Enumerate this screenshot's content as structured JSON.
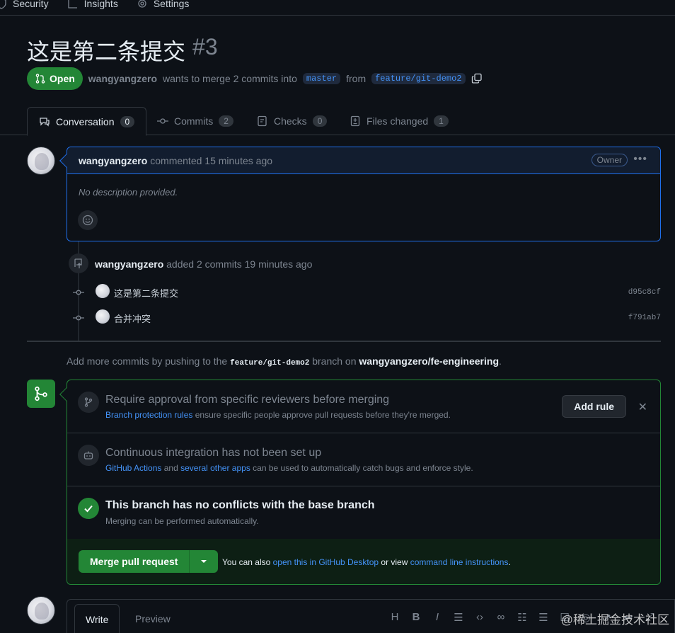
{
  "nav": {
    "security": "Security",
    "insights": "Insights",
    "settings": "Settings"
  },
  "pr": {
    "title": "这是第二条提交",
    "number": "#3",
    "state": "Open",
    "author": "wangyangzero",
    "merge_text": "wants to merge 2 commits into",
    "base": "master",
    "from_word": "from",
    "head": "feature/git-demo2"
  },
  "tabs": [
    {
      "label": "Conversation",
      "count": "0"
    },
    {
      "label": "Commits",
      "count": "2"
    },
    {
      "label": "Checks",
      "count": "0"
    },
    {
      "label": "Files changed",
      "count": "1"
    }
  ],
  "comment": {
    "author": "wangyangzero",
    "meta": "commented 15 minutes ago",
    "role": "Owner",
    "body": "No description provided."
  },
  "timeline": {
    "author": "wangyangzero",
    "event": "added 2 commits 19 minutes ago",
    "commits": [
      {
        "message": "这是第二条提交",
        "sha": "d95c8cf"
      },
      {
        "message": "合并冲突",
        "sha": "f791ab7"
      }
    ]
  },
  "push_note": {
    "prefix": "Add more commits by pushing to the",
    "branch": "feature/git-demo2",
    "middle": "branch on",
    "repo": "wangyangzero/fe-engineering",
    "suffix": "."
  },
  "merge_box": {
    "approval_title": "Require approval from specific reviewers before merging",
    "approval_link": "Branch protection rules",
    "approval_sub": "ensure specific people approve pull requests before they're merged.",
    "add_rule": "Add rule",
    "ci_title": "Continuous integration has not been set up",
    "ci_link1": "GitHub Actions",
    "ci_and": "and",
    "ci_link2": "several other apps",
    "ci_sub": "can be used to automatically catch bugs and enforce style.",
    "conflict_title": "This branch has no conflicts with the base branch",
    "conflict_sub": "Merging can be performed automatically.",
    "merge_button": "Merge pull request",
    "footer_prefix": "You can also",
    "footer_link1": "open this in GitHub Desktop",
    "footer_or": "or view",
    "footer_link2": "command line instructions",
    "footer_suffix": "."
  },
  "editor": {
    "write_tab": "Write",
    "preview_tab": "Preview",
    "toolbar_heading": "H",
    "toolbar_bold": "B",
    "toolbar_italic": "I"
  },
  "watermark": "@稀土掘金技术社区",
  "colors": {
    "background": "#0d1117",
    "accent_green": "#238636",
    "link_blue": "#4493f8",
    "border": "#30363d"
  }
}
